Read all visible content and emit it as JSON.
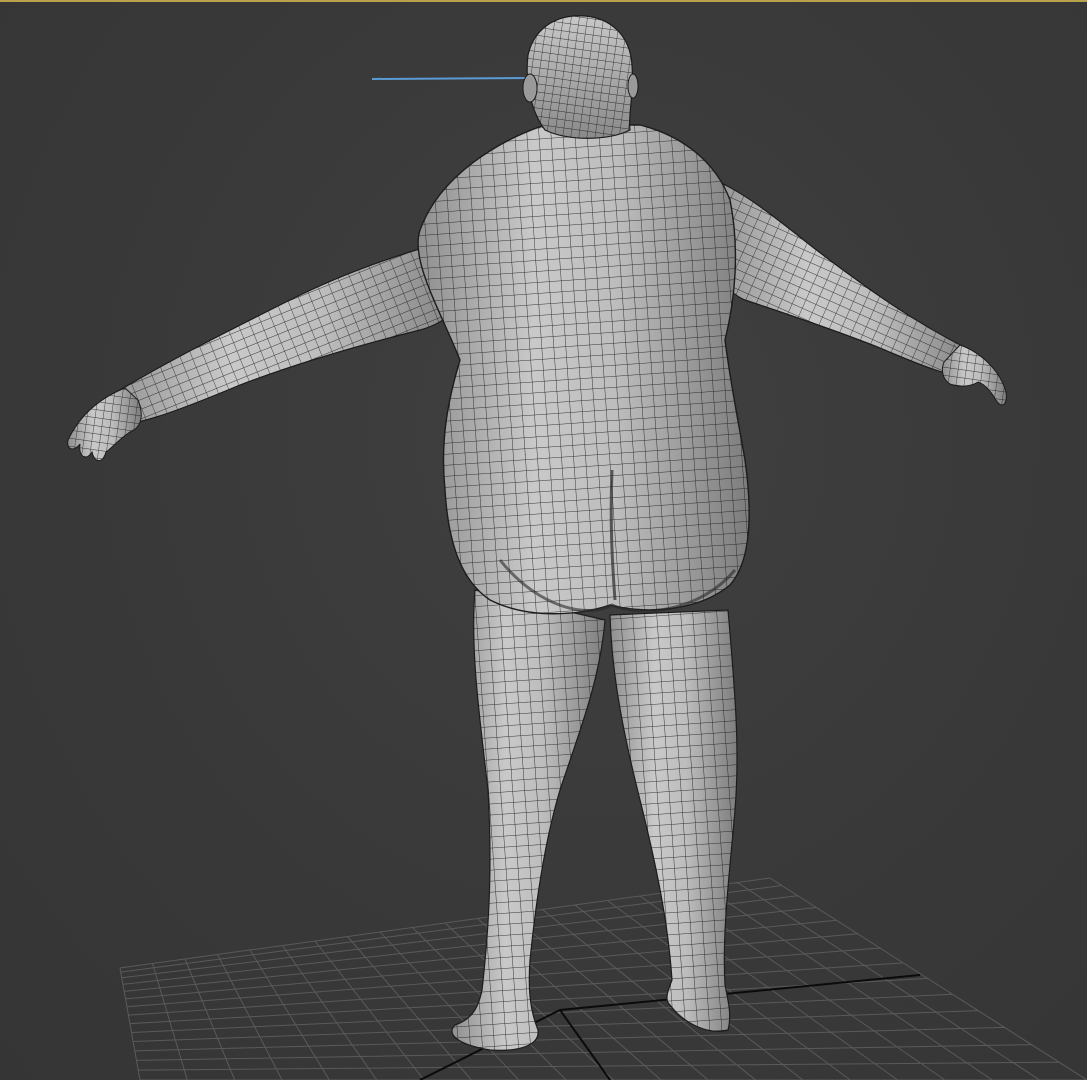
{
  "viewport": {
    "background_color": "#3a3a3a",
    "active_border_color": "#b8a24a",
    "shading": "edged-faces",
    "mesh_color": "#b9b9b9",
    "wire_color": "#1c1c1c",
    "grid_color": "#5a5a5a",
    "axis_color": "#0b0b0b",
    "helper_line_color": "#5b9bd5"
  },
  "model": {
    "icon": "polygon-mesh-icon",
    "view": "back"
  }
}
